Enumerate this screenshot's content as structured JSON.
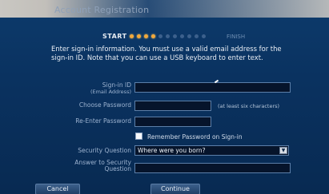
{
  "header": {
    "title": "Account Registration"
  },
  "progress": {
    "start_label": "START",
    "finish_label": "FINISH",
    "total_steps": 11,
    "current_step": 4
  },
  "intro": {
    "text": "Enter sign-in information. You must use a valid email address for the sign-in ID. Note that you can use a USB keyboard to enter text."
  },
  "form": {
    "signin_label_line1": "Sign-in ID",
    "signin_label_line2": "(Email Address)",
    "signin_value": "",
    "password_label": "Choose Password",
    "password_value": "",
    "password_hint": "(at least six characters)",
    "reenter_label": "Re-Enter Password",
    "reenter_value": "",
    "remember_label": "Remember Password on Sign-in",
    "remember_checked": false,
    "question_label": "Security Question",
    "question_value": "Where were you born?",
    "answer_label_line1": "Answer to Security",
    "answer_label_line2": "Question",
    "answer_value": ""
  },
  "buttons": {
    "cancel": "Cancel",
    "continue": "Continue"
  },
  "colors": {
    "background": "#0a3260",
    "accent_dot": "#f2a83b",
    "field_bg": "#06142b"
  }
}
